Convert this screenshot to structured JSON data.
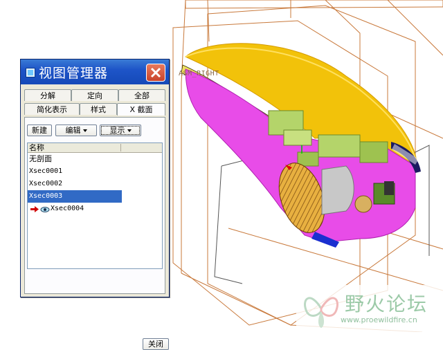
{
  "viewport": {
    "datum_label": "ASM_RIGHT",
    "colors": {
      "shell": "#f2c20a",
      "interior": "#e84ce8",
      "datum": "#c8783a",
      "component_green": "#b4d46a",
      "blue_part": "#1a2fd0"
    }
  },
  "dialog": {
    "title": "视图管理器",
    "title_icon": "view-manager-icon",
    "close_icon": "close-x-icon",
    "tabs_row1": [
      {
        "label": "分解",
        "active": false
      },
      {
        "label": "定向",
        "active": false
      },
      {
        "label": "全部",
        "active": false
      }
    ],
    "tabs_row2": [
      {
        "label": "简化表示",
        "active": false
      },
      {
        "label": "样式",
        "active": false
      },
      {
        "label": "X 截面",
        "active": true
      }
    ],
    "toolbar": {
      "new_label": "新建",
      "edit_label": "编辑",
      "display_label": "显示"
    },
    "list": {
      "column_header": "名称",
      "items": [
        {
          "label": "无剖面",
          "selected": false
        },
        {
          "label": "Xsec0001",
          "selected": false
        },
        {
          "label": "Xsec0002",
          "selected": false
        },
        {
          "label": "Xsec0003",
          "selected": true
        },
        {
          "label": "Xsec0004",
          "selected": false,
          "icons": [
            "active-arrow-icon",
            "eye-icon"
          ]
        }
      ]
    },
    "close_label": "关闭"
  },
  "watermark": {
    "title": "野火论坛",
    "url": "www.proewildfire.cn",
    "logo_icon": "butterfly-logo-icon"
  }
}
